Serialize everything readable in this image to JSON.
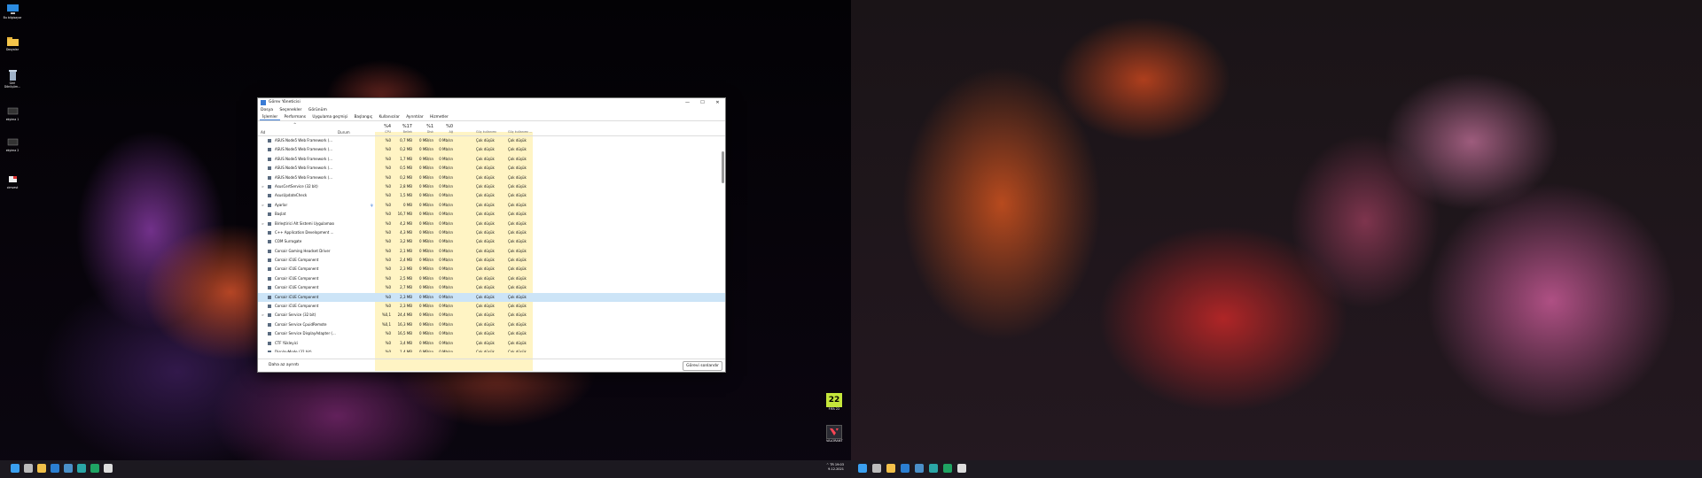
{
  "desktop_icons": [
    {
      "label": "Bu bilgisayar",
      "icon": "computer-icon"
    },
    {
      "label": "Dosyalar",
      "icon": "folder-icon"
    },
    {
      "label": "Geri Dönüşüm...",
      "icon": "recycle-bin-icon"
    },
    {
      "label": "ekyima 1",
      "icon": "monitor-shortcut-icon"
    },
    {
      "label": "ekyima 2",
      "icon": "monitor-shortcut-icon"
    },
    {
      "label": "cimvest",
      "icon": "shortcut-icon"
    }
  ],
  "widgets": {
    "fifa": {
      "badge": "22",
      "label": "FIFA 22"
    },
    "valorant": {
      "label": "VALORANT"
    }
  },
  "taskbar": {
    "time": "19:03",
    "date": "9.12.2021",
    "lang": "TR"
  },
  "window": {
    "title": "Görev Yöneticisi",
    "controls": {
      "minimize": "—",
      "maximize": "☐",
      "close": "✕"
    },
    "menu": [
      "Dosya",
      "Seçenekler",
      "Görünüm"
    ],
    "tabs": [
      "İşlemler",
      "Performans",
      "Uygulama geçmişi",
      "Başlangıç",
      "Kullanıcılar",
      "Ayrıntılar",
      "Hizmetler"
    ],
    "columns": {
      "name": "Ad",
      "status": "Durum",
      "cpu": {
        "pct": "%4",
        "label": "CPU"
      },
      "memory": {
        "pct": "%17",
        "label": "Bellek"
      },
      "disk": {
        "pct": "%1",
        "label": "Disk"
      },
      "network": {
        "pct": "%0",
        "label": "Ağ"
      },
      "power": {
        "label": "Güç kullanımı"
      },
      "power_trend": {
        "label": "Güç kullanımı ..."
      }
    },
    "rows": [
      {
        "name": "ASUS Node5 Web Framework (...",
        "cpu": "%0",
        "mem": "0,7 MB",
        "disk": "0 MB/sn",
        "net": "0 Mb/sn",
        "power": "Çok düşük",
        "trend": "Çok düşük",
        "expand": false
      },
      {
        "name": "ASUS Node5 Web Framework (...",
        "cpu": "%0",
        "mem": "0,2 MB",
        "disk": "0 MB/sn",
        "net": "0 Mb/sn",
        "power": "Çok düşük",
        "trend": "Çok düşük",
        "expand": false
      },
      {
        "name": "ASUS Node5 Web Framework (...",
        "cpu": "%0",
        "mem": "1,7 MB",
        "disk": "0 MB/sn",
        "net": "0 Mb/sn",
        "power": "Çok düşük",
        "trend": "Çok düşük",
        "expand": false
      },
      {
        "name": "ASUS Node5 Web Framework (...",
        "cpu": "%0",
        "mem": "0,5 MB",
        "disk": "0 MB/sn",
        "net": "0 Mb/sn",
        "power": "Çok düşük",
        "trend": "Çok düşük",
        "expand": false
      },
      {
        "name": "ASUS Node5 Web Framework (...",
        "cpu": "%0",
        "mem": "0,2 MB",
        "disk": "0 MB/sn",
        "net": "0 Mb/sn",
        "power": "Çok düşük",
        "trend": "Çok düşük",
        "expand": false
      },
      {
        "name": "AsusCertService (32 bit)",
        "cpu": "%0",
        "mem": "2,8 MB",
        "disk": "0 MB/sn",
        "net": "0 Mb/sn",
        "power": "Çok düşük",
        "trend": "Çok düşük",
        "expand": true
      },
      {
        "name": "AsusUpdateCheck",
        "cpu": "%0",
        "mem": "1,5 MB",
        "disk": "0 MB/sn",
        "net": "0 Mb/sn",
        "power": "Çok düşük",
        "trend": "Çok düşük",
        "expand": false
      },
      {
        "name": "Ayarlar",
        "cpu": "%0",
        "mem": "0 MB",
        "disk": "0 MB/sn",
        "net": "0 Mb/sn",
        "power": "Çok düşük",
        "trend": "Çok düşük",
        "expand": true,
        "leaf": true
      },
      {
        "name": "Başlat",
        "cpu": "%0",
        "mem": "16,7 MB",
        "disk": "0 MB/sn",
        "net": "0 Mb/sn",
        "power": "Çok düşük",
        "trend": "Çok düşük",
        "expand": false
      },
      {
        "name": "Birleştirici Alt Sistemi Uygulaması",
        "cpu": "%0",
        "mem": "4,2 MB",
        "disk": "0 MB/sn",
        "net": "0 Mb/sn",
        "power": "Çok düşük",
        "trend": "Çok düşük",
        "expand": true
      },
      {
        "name": "C++ Application Development ...",
        "cpu": "%0",
        "mem": "4,3 MB",
        "disk": "0 MB/sn",
        "net": "0 Mb/sn",
        "power": "Çok düşük",
        "trend": "Çok düşük",
        "expand": false
      },
      {
        "name": "COM Surrogate",
        "cpu": "%0",
        "mem": "3,2 MB",
        "disk": "0 MB/sn",
        "net": "0 Mb/sn",
        "power": "Çok düşük",
        "trend": "Çok düşük",
        "expand": false
      },
      {
        "name": "Corsair Gaming Headset Driver",
        "cpu": "%0",
        "mem": "2,1 MB",
        "disk": "0 MB/sn",
        "net": "0 Mb/sn",
        "power": "Çok düşük",
        "trend": "Çok düşük",
        "expand": false
      },
      {
        "name": "Corsair iCUE Component",
        "cpu": "%0",
        "mem": "2,4 MB",
        "disk": "0 MB/sn",
        "net": "0 Mb/sn",
        "power": "Çok düşük",
        "trend": "Çok düşük",
        "expand": false
      },
      {
        "name": "Corsair iCUE Component",
        "cpu": "%0",
        "mem": "2,3 MB",
        "disk": "0 MB/sn",
        "net": "0 Mb/sn",
        "power": "Çok düşük",
        "trend": "Çok düşük",
        "expand": false
      },
      {
        "name": "Corsair iCUE Component",
        "cpu": "%0",
        "mem": "2,5 MB",
        "disk": "0 MB/sn",
        "net": "0 Mb/sn",
        "power": "Çok düşük",
        "trend": "Çok düşük",
        "expand": false
      },
      {
        "name": "Corsair iCUE Component",
        "cpu": "%0",
        "mem": "2,7 MB",
        "disk": "0 MB/sn",
        "net": "0 Mb/sn",
        "power": "Çok düşük",
        "trend": "Çok düşük",
        "expand": false
      },
      {
        "name": "Corsair iCUE Component",
        "cpu": "%0",
        "mem": "2,3 MB",
        "disk": "0 MB/sn",
        "net": "0 Mb/sn",
        "power": "Çok düşük",
        "trend": "Çok düşük",
        "expand": false,
        "selected": true
      },
      {
        "name": "Corsair iCUE Component",
        "cpu": "%0",
        "mem": "2,3 MB",
        "disk": "0 MB/sn",
        "net": "0 Mb/sn",
        "power": "Çok düşük",
        "trend": "Çok düşük",
        "expand": false
      },
      {
        "name": "Corsair Service (32 bit)",
        "cpu": "%0,1",
        "mem": "24,4 MB",
        "disk": "0 MB/sn",
        "net": "0 Mb/sn",
        "power": "Çok düşük",
        "trend": "Çok düşük",
        "expand": true
      },
      {
        "name": "Corsair Service CpuidRemote",
        "cpu": "%0,1",
        "mem": "16,3 MB",
        "disk": "0 MB/sn",
        "net": "0 Mb/sn",
        "power": "Çok düşük",
        "trend": "Çok düşük",
        "expand": false
      },
      {
        "name": "Corsair Service DisplayAdapter (...",
        "cpu": "%0",
        "mem": "16,5 MB",
        "disk": "0 MB/sn",
        "net": "0 Mb/sn",
        "power": "Çok düşük",
        "trend": "Çok düşük",
        "expand": false
      },
      {
        "name": "CTF Yükleyici",
        "cpu": "%0",
        "mem": "3,4 MB",
        "disk": "0 MB/sn",
        "net": "0 Mb/sn",
        "power": "Çok düşük",
        "trend": "Çok düşük",
        "expand": false
      },
      {
        "name": "DisplayMode (32 bit)",
        "cpu": "%0",
        "mem": "1,4 MB",
        "disk": "0 MB/sn",
        "net": "0 Mb/sn",
        "power": "Çok düşük",
        "trend": "Çok düşük",
        "expand": false
      }
    ],
    "footer": {
      "less_details": "Daha az ayrıntı",
      "end_task": "Görevi sonlandır"
    }
  },
  "colors": {
    "heat_band": "#fff4c4",
    "selected_row": "#cce4f7",
    "accent": "#3a7bd5"
  }
}
